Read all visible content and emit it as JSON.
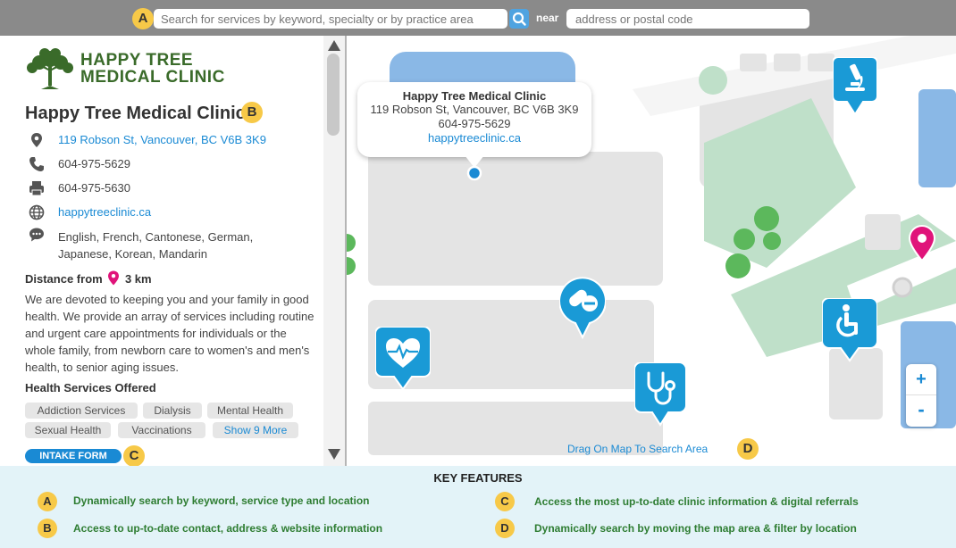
{
  "search": {
    "badge": "A",
    "keyword_placeholder": "Search for services by keyword, specialty or by practice area",
    "near_label": "near",
    "location_placeholder": "address or postal code"
  },
  "clinic": {
    "logo_line1": "HAPPY TREE",
    "logo_line2": "MEDICAL CLINIC",
    "name": "Happy Tree Medical Clinic",
    "name_badge": "B",
    "address": "119 Robson St, Vancouver, BC V6B 3K9",
    "phone": "604-975-5629",
    "fax": "604-975-5630",
    "website": "happytreeclinic.ca",
    "languages": "English, French, Cantonese, German, Japanese, Korean, Mandarin",
    "distance_label": "Distance from",
    "distance_value": "3 km",
    "description": "We are devoted to keeping you and your family in good health. We provide an array of services including routine and urgent care appointments for individuals or the whole family, from newborn care to women's and men's health, to senior aging issues.",
    "services_title": "Health Services Offered",
    "services": [
      "Addiction Services",
      "Dialysis",
      "Mental Health",
      "Sexual Health",
      "Vaccinations"
    ],
    "show_more": "Show 9 More",
    "intake_label": "INTAKE FORM",
    "intake_badge": "C"
  },
  "popup": {
    "title": "Happy Tree Medical Clinic",
    "address": "119 Robson St, Vancouver, BC V6B 3K9",
    "phone": "604-975-5629",
    "website": "happytreeclinic.ca"
  },
  "map": {
    "drag_hint": "Drag On Map To Search Area",
    "drag_badge": "D",
    "zoom_in": "+",
    "zoom_out": "-",
    "markers": [
      "microscope-icon",
      "pills-icon",
      "heart-pulse-icon",
      "stethoscope-icon",
      "wheelchair-icon"
    ],
    "marker_color": "#1a9ad6",
    "pin_color": "#e0147a"
  },
  "features": {
    "title": "KEY FEATURES",
    "items": [
      {
        "badge": "A",
        "text": "Dynamically search by keyword, service type and location"
      },
      {
        "badge": "B",
        "text": "Access to up-to-date contact, address & website information"
      },
      {
        "badge": "C",
        "text": "Access the most up-to-date clinic information & digital referrals"
      },
      {
        "badge": "D",
        "text": "Dynamically search by moving the map area & filter by location"
      }
    ]
  }
}
